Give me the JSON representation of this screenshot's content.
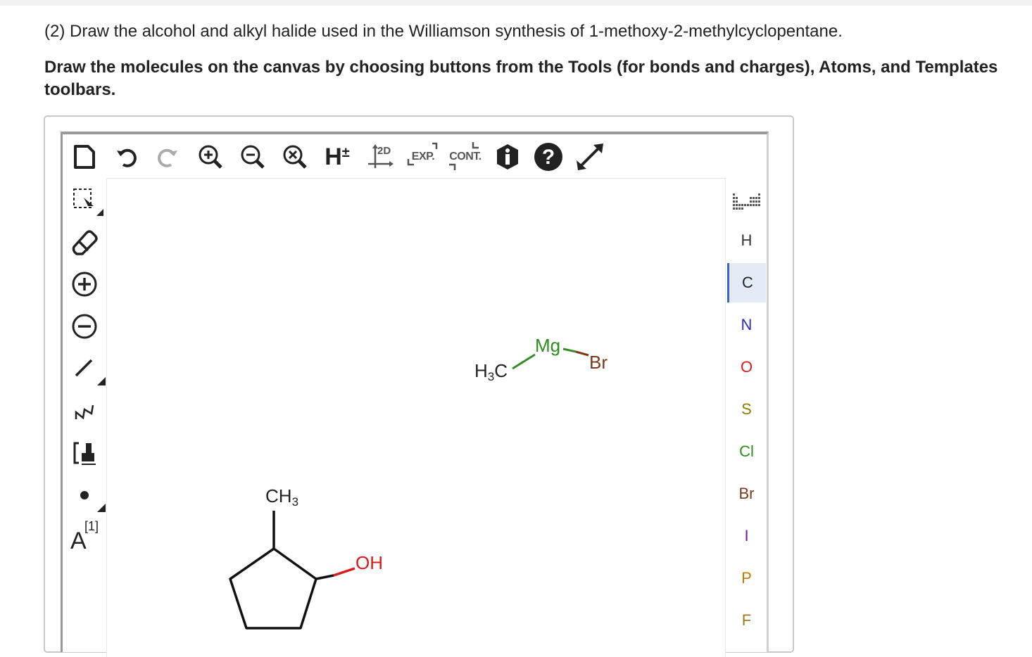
{
  "question": {
    "text": "(2) Draw the alcohol and alkyl halide used in the Williamson synthesis of 1-methoxy-2-methylcyclopentane.",
    "instruction": "Draw the molecules on the canvas by choosing buttons from the Tools (for bonds and charges), Atoms, and Templates toolbars."
  },
  "top_toolbar": {
    "buttons": [
      {
        "name": "new-document",
        "icon": "document-icon"
      },
      {
        "name": "undo",
        "icon": "undo-icon"
      },
      {
        "name": "redo",
        "icon": "redo-icon"
      },
      {
        "name": "zoom-in",
        "icon": "zoom-in-icon"
      },
      {
        "name": "zoom-out",
        "icon": "zoom-out-icon"
      },
      {
        "name": "zoom-reset",
        "icon": "zoom-reset-icon"
      },
      {
        "name": "hydrogens",
        "label": "H±"
      },
      {
        "name": "clean-2d",
        "label": "2D"
      },
      {
        "name": "expand",
        "label": "EXP."
      },
      {
        "name": "contract",
        "label": "CONT."
      },
      {
        "name": "info",
        "icon": "info-icon"
      },
      {
        "name": "help",
        "icon": "help-icon"
      },
      {
        "name": "fullscreen",
        "icon": "fullscreen-icon"
      }
    ],
    "h_label": "H",
    "h_sup": "±",
    "clean_label": "2D",
    "exp_label": "EXP.",
    "cont_label": "CONT."
  },
  "left_toolbar": {
    "tools": [
      "select",
      "erase",
      "positive-charge",
      "negative-charge",
      "single-bond",
      "chain",
      "template",
      "radical",
      "atom-map"
    ],
    "atom_map_label": "A",
    "atom_map_sup": "[1]"
  },
  "atoms_toolbar": {
    "periodic_icon": "periodic-table-icon",
    "items": [
      {
        "symbol": "H",
        "color": "#333333",
        "selected": false
      },
      {
        "symbol": "C",
        "color": "#222222",
        "selected": true
      },
      {
        "symbol": "N",
        "color": "#2b2fb5",
        "selected": false
      },
      {
        "symbol": "O",
        "color": "#d81b1b",
        "selected": false
      },
      {
        "symbol": "S",
        "color": "#8a7a00",
        "selected": false
      },
      {
        "symbol": "Cl",
        "color": "#2e8b1e",
        "selected": false
      },
      {
        "symbol": "Br",
        "color": "#7a3a1a",
        "selected": false
      },
      {
        "symbol": "I",
        "color": "#7a1aa0",
        "selected": false
      },
      {
        "symbol": "P",
        "color": "#c07a00",
        "selected": false
      },
      {
        "symbol": "F",
        "color": "#a07a20",
        "selected": false
      }
    ]
  },
  "canvas": {
    "grignard": {
      "methyl": "H",
      "methyl_sub": "3",
      "methyl_c": "C",
      "metal": "Mg",
      "halogen": "Br",
      "metal_color": "#2e8b1e",
      "halogen_color": "#7a3a1a"
    },
    "alcohol": {
      "methyl": "CH",
      "methyl_sub": "3",
      "hydroxyl": "OH",
      "hydroxyl_color": "#d81b1b"
    }
  }
}
